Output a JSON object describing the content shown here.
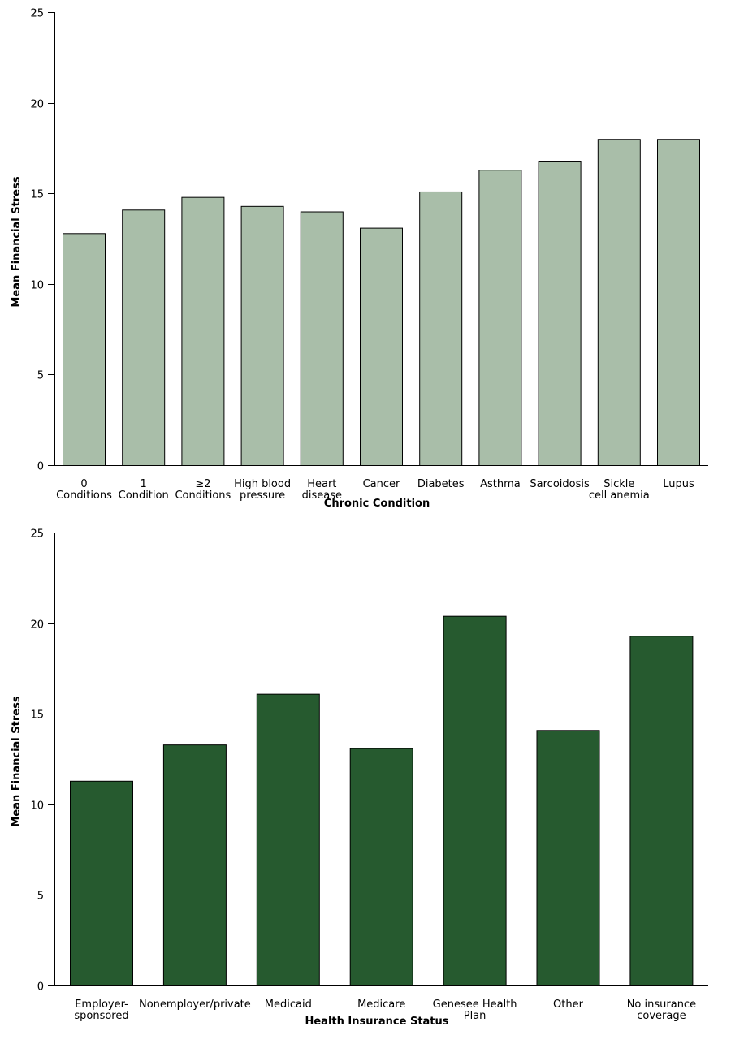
{
  "chart_data": [
    {
      "type": "bar",
      "title": "",
      "xlabel": "Chronic Condition",
      "ylabel": "Mean Financial Stress",
      "ylim": [
        0,
        25
      ],
      "yticks": [
        0,
        5,
        10,
        15,
        20,
        25
      ],
      "grid": false,
      "legend": "none",
      "bar_color": "#a9bea9",
      "categories": [
        [
          "0",
          "Conditions"
        ],
        [
          "1",
          "Condition"
        ],
        [
          "≥2",
          "Conditions"
        ],
        [
          "High blood",
          "pressure"
        ],
        [
          "Heart",
          "disease"
        ],
        [
          "Cancer"
        ],
        [
          "Diabetes"
        ],
        [
          "Asthma"
        ],
        [
          "Sarcoidosis"
        ],
        [
          "Sickle",
          "cell anemia"
        ],
        [
          "Lupus"
        ]
      ],
      "values": [
        12.8,
        14.1,
        14.8,
        14.3,
        14.0,
        13.1,
        15.1,
        16.3,
        16.8,
        18.0,
        18.0
      ]
    },
    {
      "type": "bar",
      "title": "",
      "xlabel": "Health Insurance Status",
      "ylabel": "Mean Financial Stress",
      "ylim": [
        0,
        25
      ],
      "yticks": [
        0,
        5,
        10,
        15,
        20,
        25
      ],
      "grid": false,
      "legend": "none",
      "bar_color": "#265a2f",
      "categories": [
        [
          "Employer-",
          "sponsored"
        ],
        [
          "Nonemployer/private"
        ],
        [
          "Medicaid"
        ],
        [
          "Medicare"
        ],
        [
          "Genesee Health",
          "Plan"
        ],
        [
          "Other"
        ],
        [
          "No insurance",
          "coverage"
        ]
      ],
      "values": [
        11.3,
        13.3,
        16.1,
        13.1,
        20.4,
        14.1,
        19.3
      ]
    }
  ]
}
